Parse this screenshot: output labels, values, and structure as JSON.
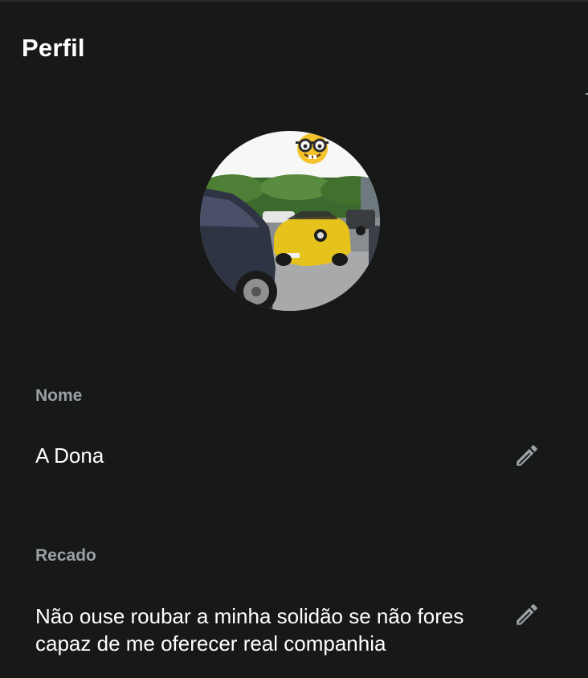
{
  "header": {
    "title": "Perfil"
  },
  "avatar": {
    "description_icon": "profile-photo"
  },
  "name_section": {
    "label": "Nome",
    "value": "A Dona",
    "edit_icon": "pencil-icon"
  },
  "about_section": {
    "label": "Recado",
    "value_line1": "Não ouse roubar a minha solidão se não fores",
    "value_line2": "capaz de me oferecer real companhia",
    "edit_icon": "pencil-icon"
  },
  "colors": {
    "background": "#171818",
    "label": "#9aa0a4",
    "text": "#ffffff",
    "icon": "#9aa0a4"
  }
}
